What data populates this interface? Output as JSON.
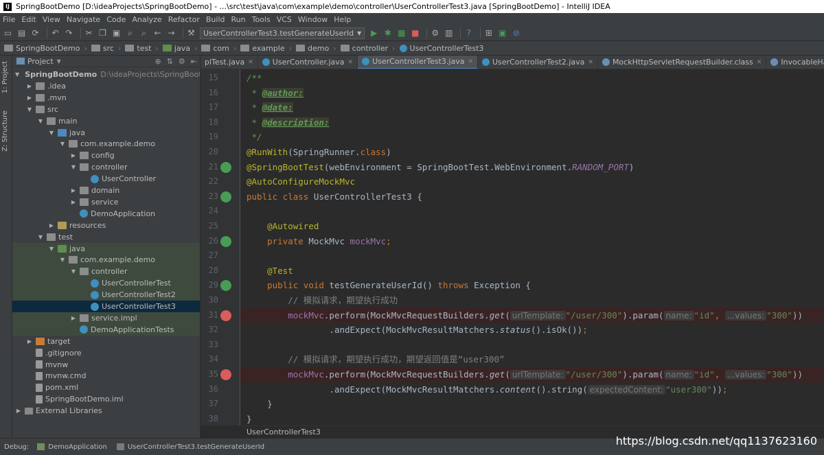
{
  "window": {
    "title": "SpringBootDemo [D:\\ideaProjects\\SpringBootDemo] - ...\\src\\test\\java\\com\\example\\demo\\controller\\UserControllerTest3.java [SpringBootDemo] - IntelliJ IDEA"
  },
  "menu": [
    "File",
    "Edit",
    "View",
    "Navigate",
    "Code",
    "Analyze",
    "Refactor",
    "Build",
    "Run",
    "Tools",
    "VCS",
    "Window",
    "Help"
  ],
  "toolbar": {
    "run_config": "UserControllerTest3.testGenerateUserId"
  },
  "breadcrumbs": [
    "SpringBootDemo",
    "src",
    "test",
    "java",
    "com",
    "example",
    "demo",
    "controller",
    "UserControllerTest3"
  ],
  "left_tabs": {
    "project": "1: Project",
    "structure": "Z: Structure"
  },
  "project_panel": {
    "header": "Project",
    "root_path": "D:\\ideaProjects\\SpringBootDem",
    "tree": [
      {
        "label": "SpringBootDemo",
        "depth": 0,
        "icon": "folder",
        "arrow": "▼",
        "bold": true
      },
      {
        "label": ".idea",
        "depth": 1,
        "icon": "folder",
        "arrow": "▶"
      },
      {
        "label": ".mvn",
        "depth": 1,
        "icon": "folder",
        "arrow": "▶"
      },
      {
        "label": "src",
        "depth": 1,
        "icon": "folder",
        "arrow": "▼"
      },
      {
        "label": "main",
        "depth": 2,
        "icon": "folder",
        "arrow": "▼"
      },
      {
        "label": "java",
        "depth": 3,
        "icon": "src",
        "arrow": "▼"
      },
      {
        "label": "com.example.demo",
        "depth": 4,
        "icon": "folder",
        "arrow": "▼"
      },
      {
        "label": "config",
        "depth": 5,
        "icon": "folder",
        "arrow": "▶"
      },
      {
        "label": "controller",
        "depth": 5,
        "icon": "folder",
        "arrow": "▼"
      },
      {
        "label": "UserController",
        "depth": 6,
        "icon": "java",
        "arrow": ""
      },
      {
        "label": "domain",
        "depth": 5,
        "icon": "folder",
        "arrow": "▶"
      },
      {
        "label": "service",
        "depth": 5,
        "icon": "folder",
        "arrow": "▶"
      },
      {
        "label": "DemoApplication",
        "depth": 5,
        "icon": "java",
        "arrow": ""
      },
      {
        "label": "resources",
        "depth": 3,
        "icon": "res",
        "arrow": "▶"
      },
      {
        "label": "test",
        "depth": 2,
        "icon": "folder",
        "arrow": "▼"
      },
      {
        "label": "java",
        "depth": 3,
        "icon": "test",
        "arrow": "▼",
        "hl": true
      },
      {
        "label": "com.example.demo",
        "depth": 4,
        "icon": "folder",
        "arrow": "▼",
        "hl": true
      },
      {
        "label": "controller",
        "depth": 5,
        "icon": "folder",
        "arrow": "▼",
        "hl": true
      },
      {
        "label": "UserControllerTest",
        "depth": 6,
        "icon": "java",
        "arrow": "",
        "hl": true
      },
      {
        "label": "UserControllerTest2",
        "depth": 6,
        "icon": "java",
        "arrow": "",
        "hl": true
      },
      {
        "label": "UserControllerTest3",
        "depth": 6,
        "icon": "java",
        "arrow": "",
        "selected": true
      },
      {
        "label": "service.impl",
        "depth": 5,
        "icon": "folder",
        "arrow": "▶",
        "hl": true
      },
      {
        "label": "DemoApplicationTests",
        "depth": 5,
        "icon": "java",
        "arrow": "",
        "hl": true
      },
      {
        "label": "target",
        "depth": 1,
        "icon": "target",
        "arrow": "▶"
      },
      {
        "label": ".gitignore",
        "depth": 1,
        "icon": "file",
        "arrow": ""
      },
      {
        "label": "mvnw",
        "depth": 1,
        "icon": "file",
        "arrow": ""
      },
      {
        "label": "mvnw.cmd",
        "depth": 1,
        "icon": "file",
        "arrow": ""
      },
      {
        "label": "pom.xml",
        "depth": 1,
        "icon": "file",
        "arrow": ""
      },
      {
        "label": "SpringBootDemo.iml",
        "depth": 1,
        "icon": "file",
        "arrow": ""
      },
      {
        "label": "External Libraries",
        "depth": 0,
        "icon": "lib",
        "arrow": "▶"
      }
    ]
  },
  "editor_tabs": [
    {
      "label": "plTest.java",
      "active": false
    },
    {
      "label": "UserController.java",
      "active": false
    },
    {
      "label": "UserControllerTest3.java",
      "active": true
    },
    {
      "label": "UserControllerTest2.java",
      "active": false
    },
    {
      "label": "MockHttpServletRequestBuilder.class",
      "active": false
    },
    {
      "label": "InvocableHandlerMethod.class",
      "active": false
    }
  ],
  "code": {
    "first_line": 15,
    "lines": [
      {
        "n": 15,
        "seg": [
          [
            "/**",
            "com"
          ]
        ]
      },
      {
        "n": 16,
        "seg": [
          [
            " * ",
            "com"
          ],
          [
            "@author:",
            "tag"
          ]
        ]
      },
      {
        "n": 17,
        "seg": [
          [
            " * ",
            "com"
          ],
          [
            "@date:",
            "tag"
          ]
        ]
      },
      {
        "n": 18,
        "seg": [
          [
            " * ",
            "com"
          ],
          [
            "@description:",
            "tag"
          ]
        ]
      },
      {
        "n": 19,
        "seg": [
          [
            " */",
            "com"
          ]
        ]
      },
      {
        "n": 20,
        "seg": [
          [
            "@RunWith",
            "ann"
          ],
          [
            "(SpringRunner.",
            ""
          ],
          [
            "class",
            "kw"
          ],
          [
            ")",
            ""
          ]
        ]
      },
      {
        "n": 21,
        "mark": "run",
        "seg": [
          [
            "@SpringBootTest",
            "ann"
          ],
          [
            "(webEnvironment = SpringBootTest.WebEnvironment.",
            ""
          ],
          [
            "RANDOM_PORT",
            "ital"
          ],
          [
            ")",
            ""
          ]
        ]
      },
      {
        "n": 22,
        "seg": [
          [
            "@AutoConfigureMockMvc",
            "ann"
          ]
        ]
      },
      {
        "n": 23,
        "mark": "run",
        "seg": [
          [
            "public class ",
            "kw"
          ],
          [
            "UserControllerTest3 {",
            ""
          ]
        ]
      },
      {
        "n": 24,
        "seg": []
      },
      {
        "n": 25,
        "seg": [
          [
            "    ",
            ""
          ],
          [
            "@Autowired",
            "ann"
          ]
        ]
      },
      {
        "n": 26,
        "mark": "run",
        "seg": [
          [
            "    ",
            ""
          ],
          [
            "private ",
            "kw"
          ],
          [
            "MockMvc ",
            ""
          ],
          [
            "mockMvc",
            "fld"
          ],
          [
            ";",
            "kw"
          ]
        ]
      },
      {
        "n": 27,
        "seg": []
      },
      {
        "n": 28,
        "seg": [
          [
            "    ",
            ""
          ],
          [
            "@Test",
            "ann"
          ]
        ]
      },
      {
        "n": 29,
        "mark": "run",
        "seg": [
          [
            "    ",
            ""
          ],
          [
            "public void ",
            "kw"
          ],
          [
            "testGenerateUserId",
            "mname"
          ],
          [
            "() ",
            ""
          ],
          [
            "throws ",
            "kw"
          ],
          [
            "Exception {",
            ""
          ]
        ]
      },
      {
        "n": 30,
        "seg": [
          [
            "        ",
            ""
          ],
          [
            "// 模拟请求，期望执行成功",
            "lc"
          ]
        ]
      },
      {
        "n": 31,
        "mark": "bp",
        "seg": [
          [
            "        ",
            ""
          ],
          [
            "mockMvc",
            "fld"
          ],
          [
            ".perform(MockMvcRequestBuilders.",
            ""
          ],
          [
            "get",
            "mi"
          ],
          [
            "(",
            ""
          ],
          [
            "urlTemplate:",
            "hint"
          ],
          [
            "\"/user/300\"",
            "str"
          ],
          [
            ").param(",
            ""
          ],
          [
            "name:",
            "hint"
          ],
          [
            "\"id\"",
            "str"
          ],
          [
            ", ",
            "kw"
          ],
          [
            "...values:",
            "hint"
          ],
          [
            "\"300\"",
            "str"
          ],
          [
            "))",
            ""
          ]
        ]
      },
      {
        "n": 32,
        "seg": [
          [
            "                ",
            ""
          ],
          [
            ".andExpect(MockMvcResultMatchers.",
            ""
          ],
          [
            "status",
            "mi"
          ],
          [
            "().isOk())",
            ""
          ],
          [
            ";",
            "kw"
          ]
        ]
      },
      {
        "n": 33,
        "seg": []
      },
      {
        "n": 34,
        "seg": [
          [
            "        ",
            ""
          ],
          [
            "// 模拟请求，期望执行成功，期望返回值是“user300”",
            "lc"
          ]
        ]
      },
      {
        "n": 35,
        "mark": "bp",
        "seg": [
          [
            "        ",
            ""
          ],
          [
            "mockMvc",
            "fld"
          ],
          [
            ".perform(MockMvcRequestBuilders.",
            ""
          ],
          [
            "get",
            "mi"
          ],
          [
            "(",
            ""
          ],
          [
            "urlTemplate:",
            "hint"
          ],
          [
            "\"/user/300\"",
            "str"
          ],
          [
            ").param(",
            ""
          ],
          [
            "name:",
            "hint"
          ],
          [
            "\"id\"",
            "str"
          ],
          [
            ", ",
            "kw"
          ],
          [
            "...values:",
            "hint"
          ],
          [
            "\"300\"",
            "str"
          ],
          [
            "))",
            ""
          ]
        ]
      },
      {
        "n": 36,
        "seg": [
          [
            "                ",
            ""
          ],
          [
            ".andExpect(MockMvcResultMatchers.",
            ""
          ],
          [
            "content",
            "mi"
          ],
          [
            "().string(",
            ""
          ],
          [
            "expectedContent:",
            "hint"
          ],
          [
            "\"user300\"",
            "str"
          ],
          [
            "))",
            ""
          ],
          [
            ";",
            "kw"
          ]
        ]
      },
      {
        "n": 37,
        "seg": [
          [
            "    }",
            ""
          ]
        ]
      },
      {
        "n": 38,
        "seg": [
          [
            "}",
            ""
          ]
        ]
      }
    ]
  },
  "editor_footer": "UserControllerTest3",
  "status": {
    "debug_label": "Debug:",
    "tab1": "DemoApplication",
    "tab2": "UserControllerTest3.testGenerateUserId"
  },
  "watermark": "https://blog.csdn.net/qq1137623160"
}
